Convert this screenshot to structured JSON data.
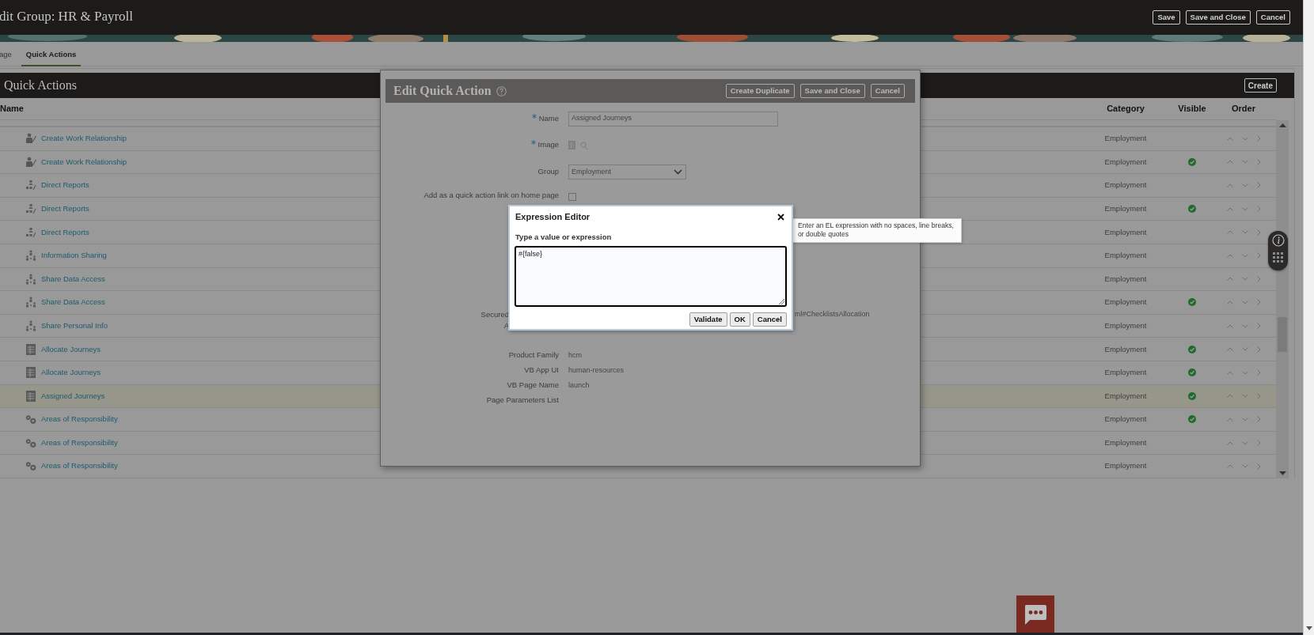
{
  "header": {
    "title": "dit Group: HR & Payroll",
    "buttons": [
      "Save",
      "Save and Close",
      "Cancel"
    ]
  },
  "tabs": [
    {
      "label": "age",
      "selected": false
    },
    {
      "label": "Quick Actions",
      "selected": true
    }
  ],
  "panel": {
    "title": "Quick Actions",
    "create_button": "Create"
  },
  "table": {
    "columns": [
      "Name",
      "Category",
      "Visible",
      "Order"
    ],
    "rows": [
      {
        "name": "Create Work Relationship",
        "kind": "person",
        "category": "Employment",
        "visible": false,
        "selected": false
      },
      {
        "name": "Create Work Relationship",
        "kind": "person",
        "category": "Employment",
        "visible": true,
        "selected": false
      },
      {
        "name": "Direct Reports",
        "kind": "org",
        "category": "Employment",
        "visible": false,
        "selected": false
      },
      {
        "name": "Direct Reports",
        "kind": "org",
        "category": "Employment",
        "visible": true,
        "selected": false
      },
      {
        "name": "Direct Reports",
        "kind": "org",
        "category": "Employment",
        "visible": false,
        "selected": false
      },
      {
        "name": "Information Sharing",
        "kind": "share",
        "category": "Employment",
        "visible": false,
        "selected": false
      },
      {
        "name": "Share Data Access",
        "kind": "share",
        "category": "Employment",
        "visible": false,
        "selected": false
      },
      {
        "name": "Share Data Access",
        "kind": "share",
        "category": "Employment",
        "visible": true,
        "selected": false
      },
      {
        "name": "Share Personal Info",
        "kind": "share",
        "category": "Employment",
        "visible": false,
        "selected": false
      },
      {
        "name": "Allocate Journeys",
        "kind": "table",
        "category": "Employment",
        "visible": true,
        "selected": false
      },
      {
        "name": "Allocate Journeys",
        "kind": "table",
        "category": "Employment",
        "visible": true,
        "selected": false
      },
      {
        "name": "Assigned Journeys",
        "kind": "table",
        "category": "Employment",
        "visible": true,
        "selected": true
      },
      {
        "name": "Areas of Responsibility",
        "kind": "gears",
        "category": "Employment",
        "visible": true,
        "selected": false
      },
      {
        "name": "Areas of Responsibility",
        "kind": "gears",
        "category": "Employment",
        "visible": false,
        "selected": false
      },
      {
        "name": "Areas of Responsibility",
        "kind": "gears",
        "category": "Employment",
        "visible": false,
        "selected": false
      }
    ]
  },
  "edit_dialog": {
    "title": "Edit Quick Action",
    "buttons": [
      "Create Duplicate",
      "Save and Close",
      "Cancel"
    ],
    "fields": [
      {
        "kind": "text",
        "label": "Name",
        "required": true,
        "value": "Assigned Journeys"
      },
      {
        "label": "Image",
        "required": true
      },
      {
        "kind": "select",
        "label": "Group",
        "required": false,
        "value": "Employment"
      },
      {
        "kind": "checkbox",
        "label": "Add as a quick action link on home page",
        "checked": false
      },
      {
        "kind": "partial",
        "label": "Secured",
        "value": "ml#ChecklistsAllocation"
      },
      {
        "kind": "partial",
        "label": "A"
      },
      {
        "kind": "readonly",
        "label": "Product Family",
        "value": "hcm"
      },
      {
        "kind": "readonly",
        "label": "VB App UI",
        "value": "human-resources"
      },
      {
        "kind": "readonly",
        "label": "VB Page Name",
        "value": "launch"
      },
      {
        "kind": "readonly",
        "label": "Page Parameters List"
      }
    ]
  },
  "expression_editor": {
    "title": "Expression Editor",
    "prompt": "Type a value or expression",
    "value": "#{false}",
    "buttons": [
      "Validate",
      "OK",
      "Cancel"
    ]
  },
  "tooltip": {
    "text": "Enter an EL expression with no spaces, line breaks, or double quotes"
  }
}
